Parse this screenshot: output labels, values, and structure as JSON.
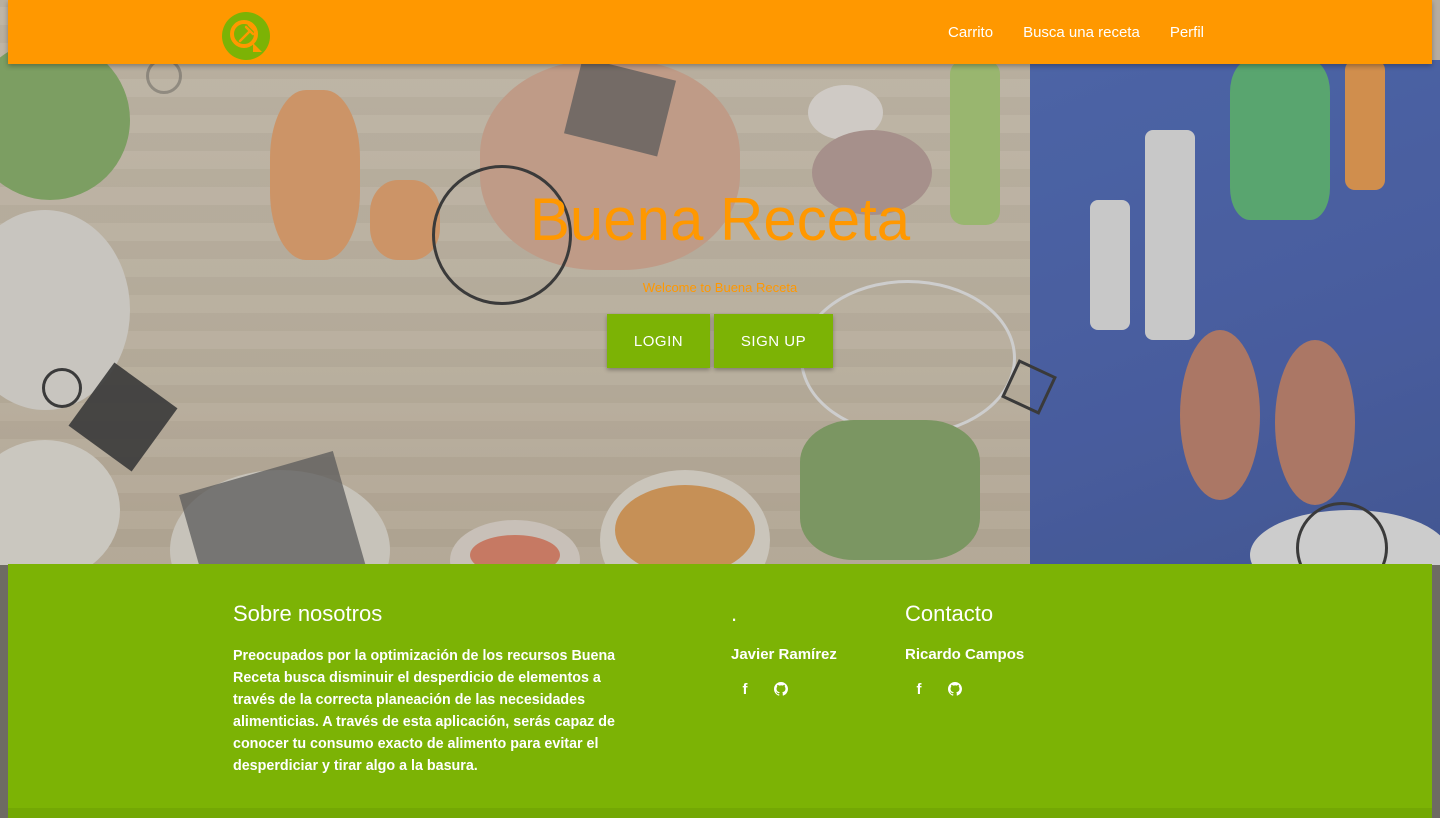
{
  "brand": {
    "logo_icon": "fork-chat-bubble-icon",
    "color_primary": "#ff9800",
    "color_secondary": "#7cb305"
  },
  "nav": {
    "items": [
      {
        "label": "Carrito"
      },
      {
        "label": "Busca una receta"
      },
      {
        "label": "Perfil"
      }
    ]
  },
  "hero": {
    "title": "Buena Receta",
    "subtitle": "Welcome to Buena Receta",
    "login_label": "LOGIN",
    "signup_label": "SIGN UP"
  },
  "footer": {
    "about": {
      "heading": "Sobre nosotros",
      "text": "Preocupados por la optimización de los recursos Buena Receta busca disminuir el desperdicio de elementos a través de la correcta planeación de las necesidades alimenticias. A través de esta aplicación, serás capaz de conocer tu consumo exacto de alimento para evitar el desperdiciar y tirar algo a la basura."
    },
    "team": {
      "heading": ".",
      "name": "Javier Ramírez",
      "icons": [
        "facebook-icon",
        "github-icon"
      ]
    },
    "contact": {
      "heading": "Contacto",
      "name": "Ricardo Campos",
      "icons": [
        "facebook-icon",
        "github-icon"
      ]
    }
  }
}
